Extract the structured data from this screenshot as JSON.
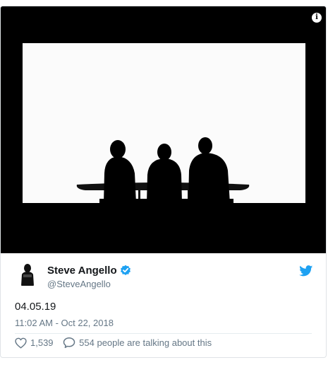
{
  "tweet": {
    "author_name": "Steve Angello",
    "handle": "@SteveAngello",
    "text": "04.05.19",
    "timestamp": "11:02 AM - Oct 22, 2018",
    "likes": "1,539",
    "replies_text": "554 people are talking about this"
  },
  "colors": {
    "verified": "#1da1f2",
    "twitter_bird": "#1da1f2",
    "secondary_text": "#657786",
    "primary_text": "#14171a"
  },
  "icons": {
    "info": "info-icon",
    "verified": "verified-badge-icon",
    "bird": "twitter-bird-icon",
    "like": "heart-icon",
    "reply": "speech-bubble-icon"
  }
}
